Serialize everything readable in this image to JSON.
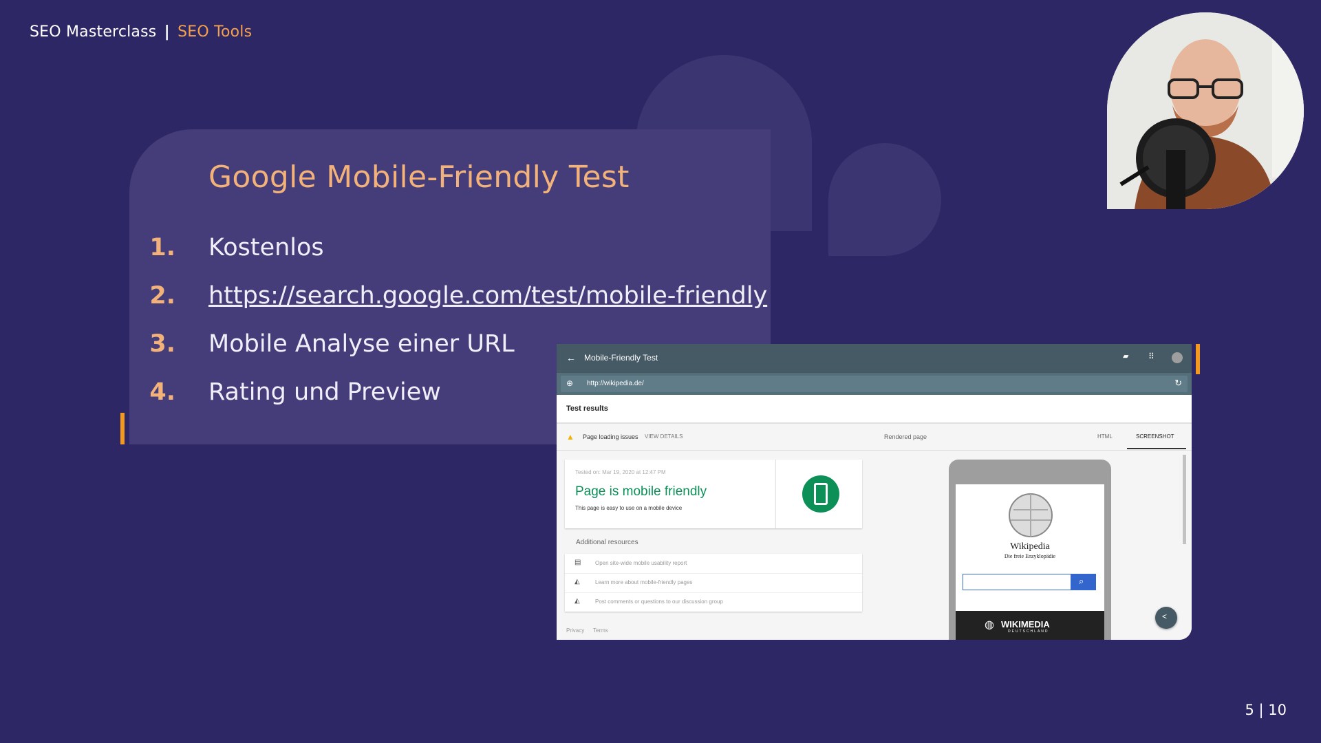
{
  "header": {
    "course": "SEO Masterclass",
    "separator": "|",
    "topic": "SEO Tools"
  },
  "slide": {
    "title": "Google Mobile-Friendly Test",
    "items": [
      {
        "num": "1.",
        "text": "Kostenlos"
      },
      {
        "num": "2.",
        "text": "https://search.google.com/test/mobile-friendly"
      },
      {
        "num": "3.",
        "text": "Mobile Analyse einer URL"
      },
      {
        "num": "4.",
        "text": "Rating und Preview"
      }
    ]
  },
  "page_number": "5 | 10",
  "colors": {
    "background": "#2d2865",
    "card": "#443d79",
    "accent": "#f5a04a",
    "bar": "#f39a1e"
  },
  "screenshot": {
    "app_title": "Mobile-Friendly Test",
    "url": "http://wikipedia.de/",
    "test_results": "Test results",
    "loading_issues": "Page loading issues",
    "view_details": "VIEW DETAILS",
    "rendered_page": "Rendered page",
    "tab_html": "HTML",
    "tab_screenshot": "SCREENSHOT",
    "tested_on": "Tested on: Mar 19, 2020 at 12:47 PM",
    "result_title": "Page is mobile friendly",
    "result_subtitle": "This page is easy to use on a mobile device",
    "additional_resources": "Additional resources",
    "resources": [
      "Open site-wide mobile usability report",
      "Learn more about mobile-friendly pages",
      "Post comments or questions to our discussion group"
    ],
    "footer_links": [
      "Privacy",
      "Terms"
    ],
    "wiki_name": "Wikipedia",
    "wiki_tagline": "Die freie Enzyklopädie",
    "wikimedia": "WIKIMEDIA",
    "wikimedia_sub": "DEUTSCHLAND",
    "icons": [
      "back-arrow-icon",
      "feedback-icon",
      "apps-grid-icon",
      "account-avatar-icon",
      "globe-icon",
      "reload-icon",
      "warning-icon",
      "phone-icon",
      "report-icon",
      "school-icon",
      "search-icon",
      "share-icon"
    ]
  }
}
